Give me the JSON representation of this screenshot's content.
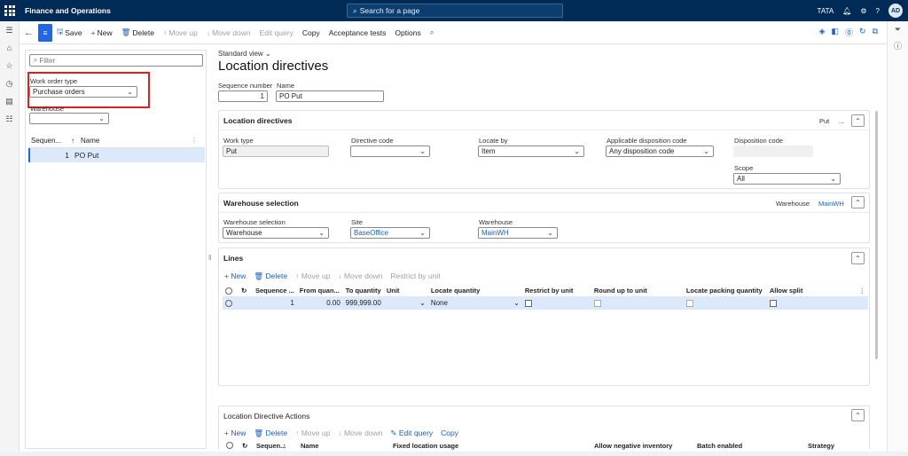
{
  "app": {
    "title": "Finance and Operations",
    "search_placeholder": "Search for a page",
    "company": "TATA",
    "user_initials": "AD"
  },
  "actions": {
    "save": "Save",
    "new": "New",
    "delete": "Delete",
    "move_up": "Move up",
    "move_down": "Move down",
    "edit_query": "Edit query",
    "copy": "Copy",
    "acceptance_tests": "Acceptance tests",
    "options": "Options"
  },
  "left_panel": {
    "filter_placeholder": "Filter",
    "work_order_type_label": "Work order type",
    "work_order_type_value": "Purchase orders",
    "warehouse_label": "Warehouse",
    "warehouse_value": "",
    "columns": [
      "Sequen...",
      "Name"
    ],
    "rows": [
      {
        "seq": "1",
        "name": "PO Put"
      }
    ]
  },
  "page": {
    "view": "Standard view",
    "title": "Location directives",
    "sequence_label": "Sequence number",
    "sequence_value": "1",
    "name_label": "Name",
    "name_value": "PO Put"
  },
  "directives_card": {
    "title": "Location directives",
    "summary": "Put",
    "summary_more": "...",
    "work_type_label": "Work type",
    "work_type_value": "Put",
    "directive_code_label": "Directive code",
    "directive_code_value": "",
    "locate_by_label": "Locate by",
    "locate_by_value": "Item",
    "disposition_label": "Applicable disposition code",
    "disposition_value": "Any disposition code",
    "disp_code_label": "Disposition code",
    "disp_code_value": "",
    "scope_label": "Scope",
    "scope_value": "All"
  },
  "warehouse_card": {
    "title": "Warehouse selection",
    "summary1": "Warehouse",
    "summary2": "MainWH",
    "sel_label": "Warehouse selection",
    "sel_value": "Warehouse",
    "site_label": "Site",
    "site_value": "BaseOffice",
    "wh_label": "Warehouse",
    "wh_value": "MainWH"
  },
  "lines_card": {
    "title": "Lines",
    "toolbar": {
      "new": "New",
      "delete": "Delete",
      "move_up": "Move up",
      "move_down": "Move down",
      "restrict": "Restrict by unit"
    },
    "columns": [
      "Sequence ...",
      "From quan...",
      "To quantity",
      "Unit",
      "Locate quantity",
      "Restrict by unit",
      "Round up to unit",
      "Locate packing quantity",
      "Allow split"
    ],
    "row": {
      "seq": "1",
      "from": "0.00",
      "to": "999,999.00",
      "unit": "",
      "locate": "None"
    }
  },
  "actions_card": {
    "title": "Location Directive Actions",
    "toolbar": {
      "new": "New",
      "delete": "Delete",
      "move_up": "Move up",
      "move_down": "Move down",
      "edit_query": "Edit query",
      "copy": "Copy"
    },
    "columns": [
      "Sequen...",
      "Name",
      "Fixed location usage",
      "Allow negative inventory",
      "Batch enabled",
      "Strategy"
    ]
  },
  "colors": {
    "topbar": "#012b57",
    "accent": "#2266e3",
    "highlight": "#e01e1e"
  }
}
